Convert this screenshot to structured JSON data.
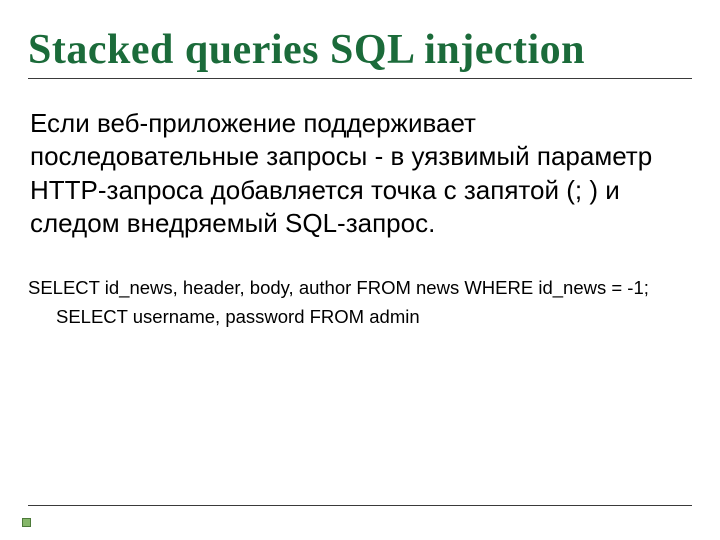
{
  "title": "Stacked queries SQL injection",
  "body": "Если веб-приложение поддерживает последовательные запросы - в уязвимый параметр HTTP-запроса  добавляется точка с запятой (; ) и следом внедряемый SQL-запрос.",
  "code": {
    "line1": "SELECT id_news, header, body, author FROM news WHERE id_news = -1;",
    "line2": "SELECT username, password FROM admin"
  }
}
